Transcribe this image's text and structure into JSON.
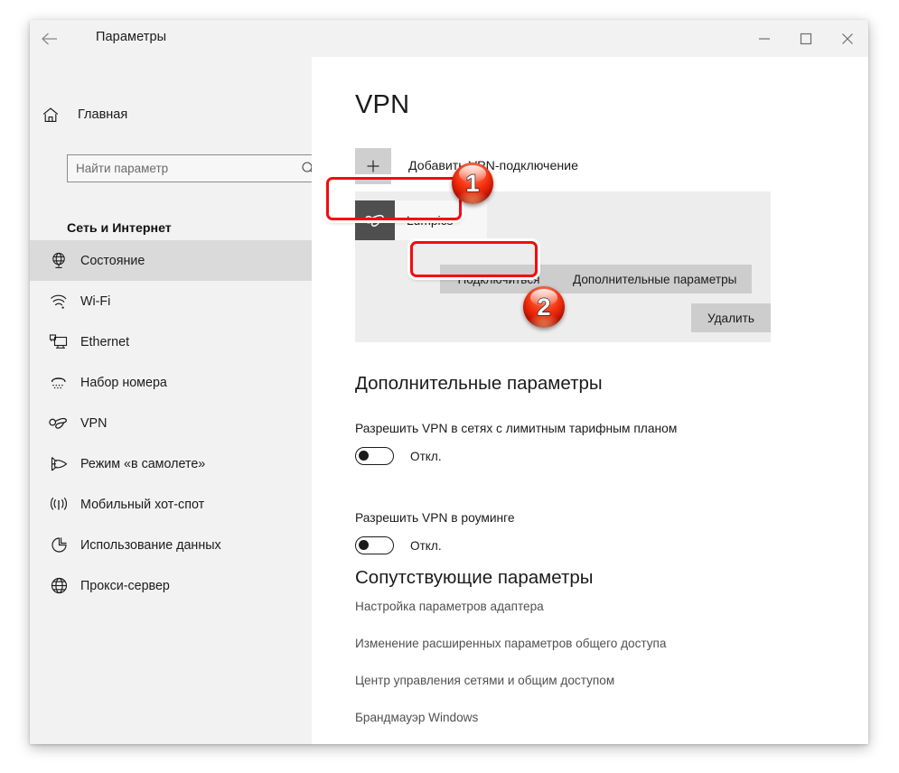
{
  "window": {
    "title": "Параметры",
    "back_icon": "back-arrow-icon",
    "controls": {
      "minimize": "—",
      "maximize": "□",
      "close": "✕"
    }
  },
  "sidebar": {
    "home": {
      "label": "Главная",
      "icon": "home-icon"
    },
    "search": {
      "placeholder": "Найти параметр",
      "value": "",
      "icon": "search-icon"
    },
    "group_heading": "Сеть и Интернет",
    "items": [
      {
        "label": "Состояние",
        "icon": "globe-status-icon",
        "selected": true
      },
      {
        "label": "Wi-Fi",
        "icon": "wifi-icon",
        "selected": false
      },
      {
        "label": "Ethernet",
        "icon": "ethernet-icon",
        "selected": false
      },
      {
        "label": "Набор номера",
        "icon": "dialup-icon",
        "selected": false
      },
      {
        "label": "VPN",
        "icon": "vpn-knot-icon",
        "selected": false
      },
      {
        "label": "Режим «в самолете»",
        "icon": "airplane-icon",
        "selected": false
      },
      {
        "label": "Мобильный хот-спот",
        "icon": "hotspot-icon",
        "selected": false
      },
      {
        "label": "Использование данных",
        "icon": "data-usage-icon",
        "selected": false
      },
      {
        "label": "Прокси-сервер",
        "icon": "proxy-globe-icon",
        "selected": false
      }
    ]
  },
  "main": {
    "page_title": "VPN",
    "add_connection": {
      "label": "Добавить VPN-подключение",
      "icon": "plus-icon"
    },
    "vpn_entry": {
      "name": "Lumpics",
      "icon": "vpn-knot-icon"
    },
    "buttons": {
      "connect": "Подключиться",
      "advanced": "Дополнительные параметры",
      "delete": "Удалить"
    },
    "advanced_section": {
      "title": "Дополнительные параметры",
      "options": [
        {
          "label": "Разрешить VPN в сетях с лимитным тарифным планом",
          "state": "Откл.",
          "on": false
        },
        {
          "label": "Разрешить VPN в роуминге",
          "state": "Откл.",
          "on": false
        }
      ]
    },
    "related_section": {
      "title": "Сопутствующие параметры",
      "links": [
        "Настройка параметров адаптера",
        "Изменение расширенных параметров общего доступа",
        "Центр управления сетями и общим доступом",
        "Брандмауэр Windows"
      ]
    }
  },
  "annotations": {
    "badges": [
      {
        "number": "1",
        "target": "vpn-entry-Lumpics"
      },
      {
        "number": "2",
        "target": "connect-button"
      }
    ],
    "highlight_color": "#f50b0b"
  }
}
